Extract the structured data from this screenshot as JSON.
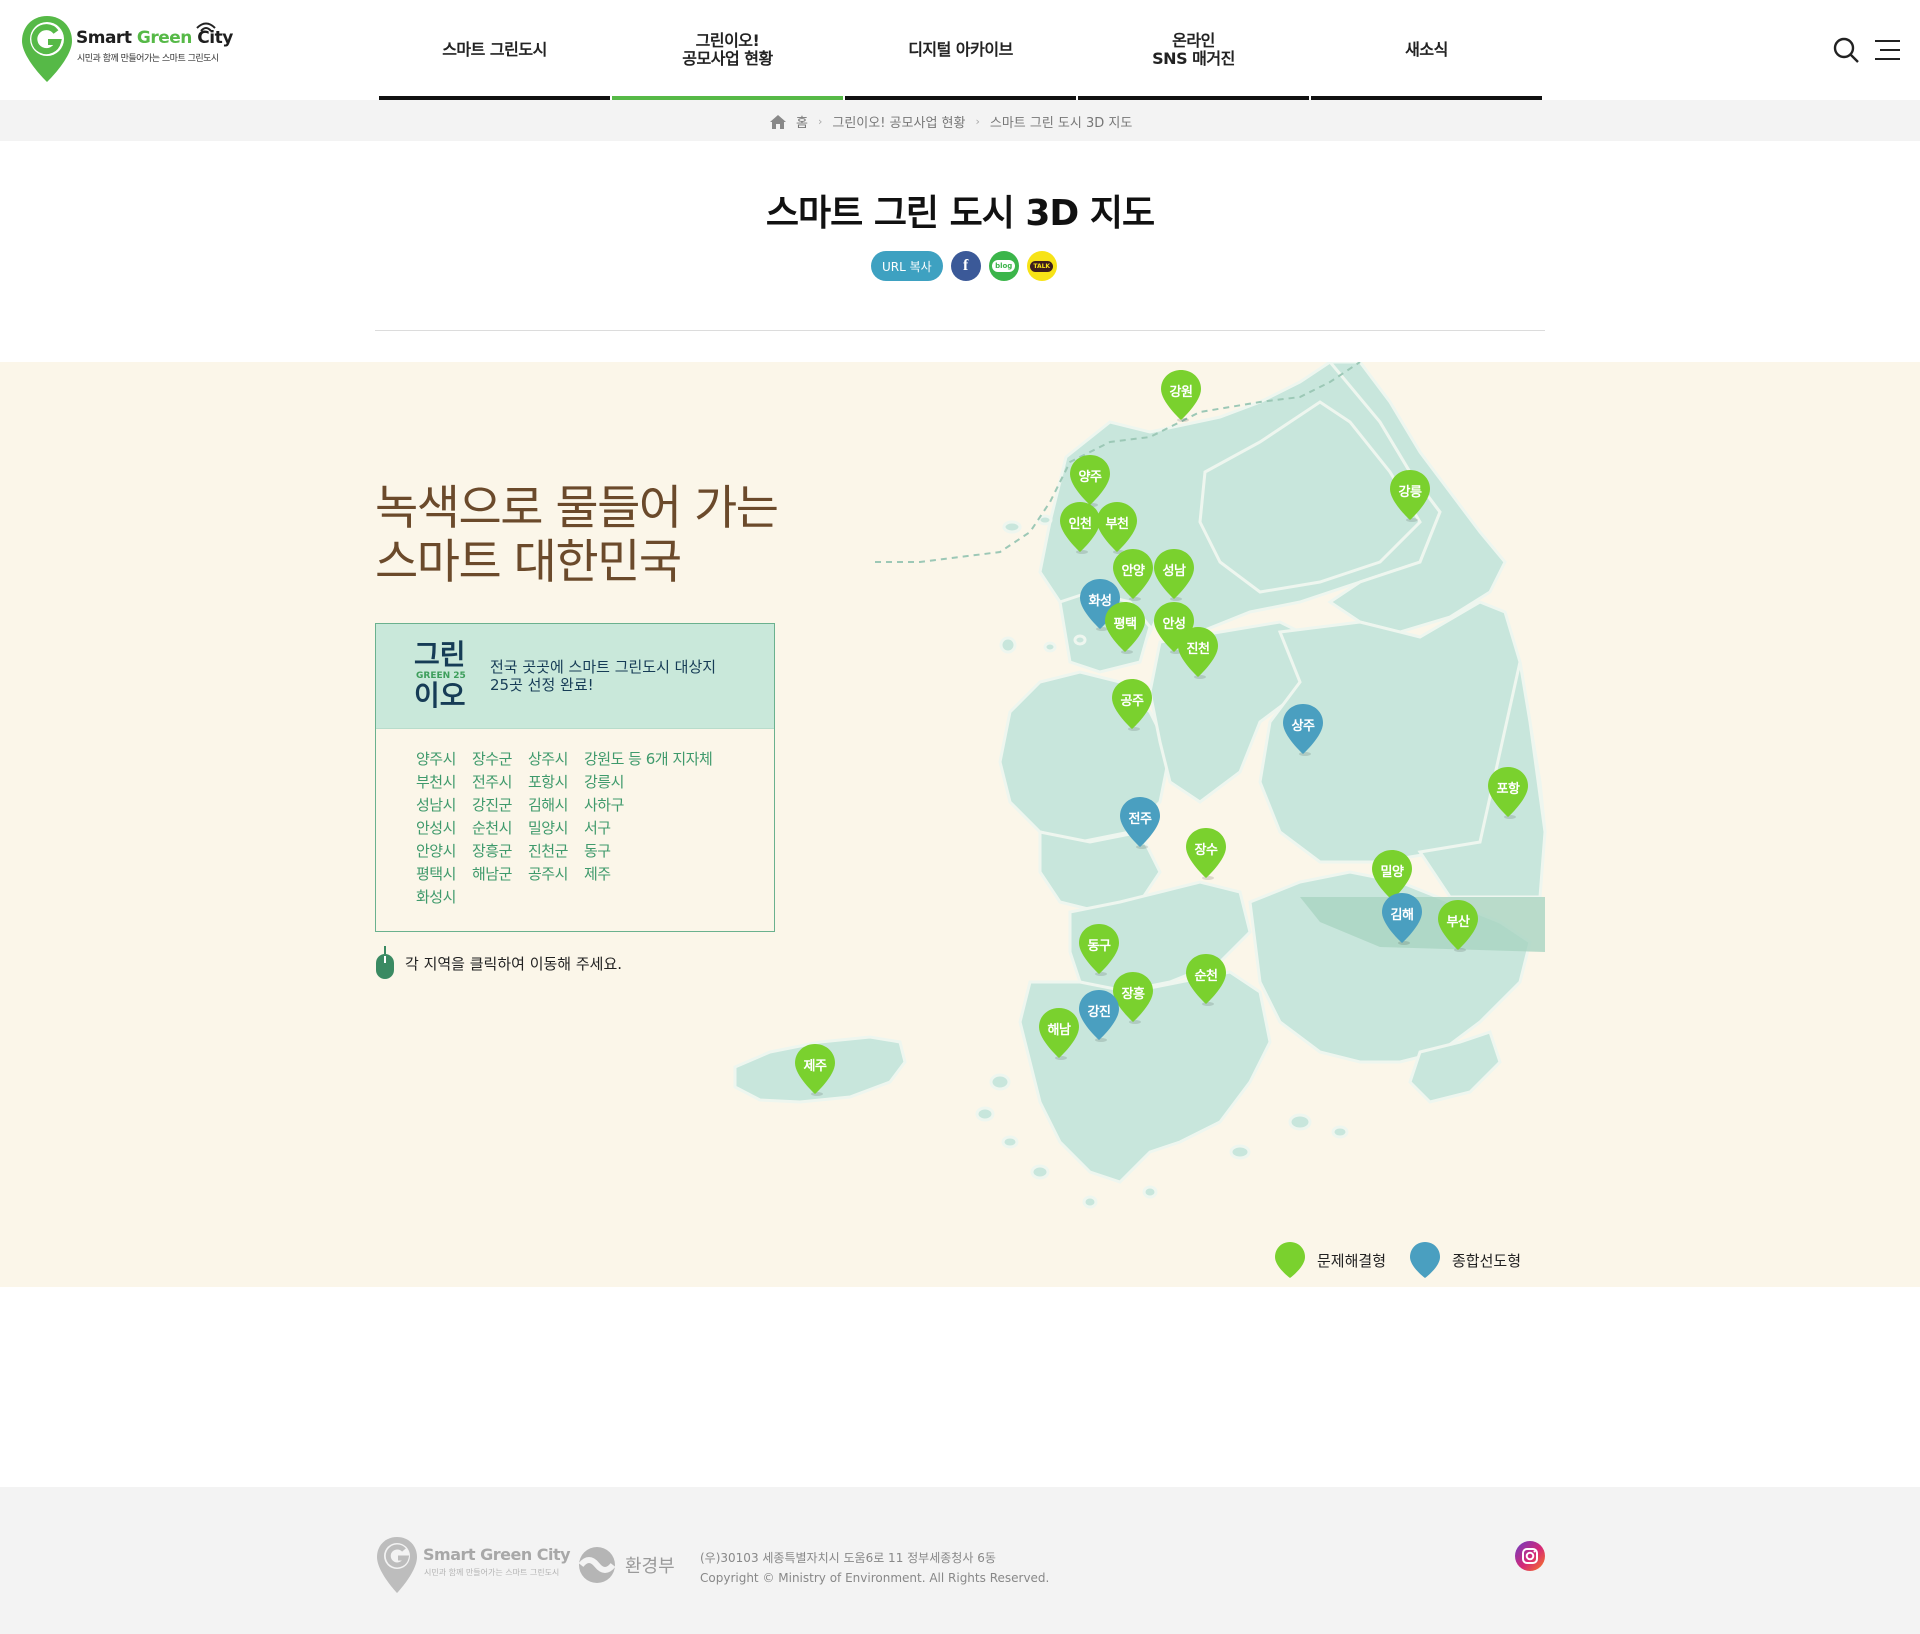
{
  "header": {
    "logo_main_1": "Smart ",
    "logo_main_2": "Green",
    "logo_main_3": " City",
    "logo_sub": "시민과 함께 만들어가는 스마트 그린도시",
    "nav": [
      {
        "label": "스마트 그린도시"
      },
      {
        "label": "그린이오!\n공모사업 현황"
      },
      {
        "label": "디지털 아카이브"
      },
      {
        "label": "온라인\nSNS 매거진"
      },
      {
        "label": "새소식"
      }
    ]
  },
  "breadcrumb": {
    "home": "홈",
    "level1": "그린이오! 공모사업 현황",
    "level2": "스마트 그린 도시 3D 지도"
  },
  "page": {
    "title": "스마트 그린 도시 3D 지도",
    "url_copy": "URL 복사",
    "blog": "blog",
    "talk": "TALK"
  },
  "section": {
    "headline_1": "녹색으로 물들어 가는",
    "headline_2": "스마트 대한민국",
    "badge_1": "그린",
    "badge_2": "GREEN 25",
    "badge_3": "이오",
    "message_1": "전국 곳곳에 스마트 그린도시 대상지",
    "message_2": "25곳 선정 완료!",
    "regions": [
      "양주시",
      "장수군",
      "상주시",
      "강원도 등 6개 지자체",
      "부천시",
      "전주시",
      "포항시",
      "강릉시",
      "성남시",
      "강진군",
      "김해시",
      "사하구",
      "안성시",
      "순천시",
      "밀양시",
      "서구",
      "안양시",
      "장흥군",
      "진천군",
      "동구",
      "평택시",
      "해남군",
      "공주시",
      "제주",
      "화성시"
    ],
    "hint": "각 지역을 클릭하여 이동해 주세요."
  },
  "map": {
    "pins": [
      {
        "label": "강원",
        "type": "green"
      },
      {
        "label": "강릉",
        "type": "green"
      },
      {
        "label": "양주",
        "type": "green"
      },
      {
        "label": "인천",
        "type": "green"
      },
      {
        "label": "부천",
        "type": "green"
      },
      {
        "label": "안양",
        "type": "green"
      },
      {
        "label": "성남",
        "type": "green"
      },
      {
        "label": "화성",
        "type": "blue"
      },
      {
        "label": "평택",
        "type": "green"
      },
      {
        "label": "안성",
        "type": "green"
      },
      {
        "label": "진천",
        "type": "green"
      },
      {
        "label": "공주",
        "type": "green"
      },
      {
        "label": "상주",
        "type": "blue"
      },
      {
        "label": "포항",
        "type": "green"
      },
      {
        "label": "전주",
        "type": "blue"
      },
      {
        "label": "장수",
        "type": "green"
      },
      {
        "label": "밀양",
        "type": "green"
      },
      {
        "label": "김해",
        "type": "blue"
      },
      {
        "label": "부산",
        "type": "green"
      },
      {
        "label": "동구",
        "type": "green"
      },
      {
        "label": "순천",
        "type": "green"
      },
      {
        "label": "장흥",
        "type": "green"
      },
      {
        "label": "강진",
        "type": "blue"
      },
      {
        "label": "해남",
        "type": "green"
      },
      {
        "label": "제주",
        "type": "green"
      }
    ],
    "legend_green": "문제해결형",
    "legend_blue": "종합선도형"
  },
  "footer": {
    "logo_main": "Smart Green City",
    "logo_sub": "시민과 함께 만들어가는 스마트 그린도시",
    "ministry": "환경부",
    "address": "(우)30103 세종특별자치시 도움6로 11 정부세종청사 6동",
    "copyright": "Copyright © Ministry of Environment. All Rights Reserved."
  },
  "colors": {
    "accent_green": "#56b947",
    "pin_green": "#7ad12e",
    "pin_blue": "#4a9fc0",
    "map_land": "#c8e6dc",
    "section_bg": "#fbf6e9",
    "headline_brown": "#6b4a2b"
  }
}
